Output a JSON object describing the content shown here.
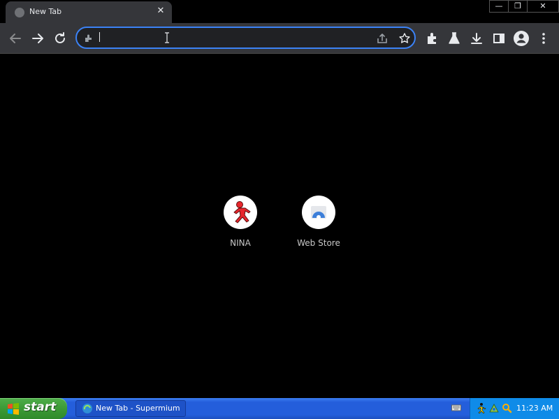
{
  "tab": {
    "title": "New Tab",
    "close_glyph": "✕",
    "favicon": "globe-icon"
  },
  "window_controls": {
    "minimize": "—",
    "restore": "❐",
    "close": "✕"
  },
  "omnibox": {
    "value": "",
    "placeholder": "",
    "site_icon": "extension-icon"
  },
  "toolbar": {
    "icons": [
      "back-arrow-icon",
      "forward-arrow-icon",
      "reload-icon",
      "share-icon",
      "star-icon",
      "extensions-icon",
      "labs-icon",
      "download-icon",
      "side-panel-icon",
      "profile-icon",
      "menu-icon"
    ]
  },
  "shortcuts": [
    {
      "label": "NINA",
      "icon": "running-man-icon",
      "accent": "#e8262c"
    },
    {
      "label": "Web Store",
      "icon": "web-store-icon",
      "accent": "#3d7fd9"
    }
  ],
  "taskbar": {
    "start_label": "start",
    "task_button": "New Tab - Supermium",
    "clock": "11:23 AM",
    "colors": {
      "bar": "#245edb",
      "start": "#3c9a36",
      "tray": "#0f8be8"
    }
  },
  "colors": {
    "toolbar": "#35363a",
    "tab": "#35363a",
    "omnibox_focus": "#3b82f6",
    "page": "#000000"
  }
}
